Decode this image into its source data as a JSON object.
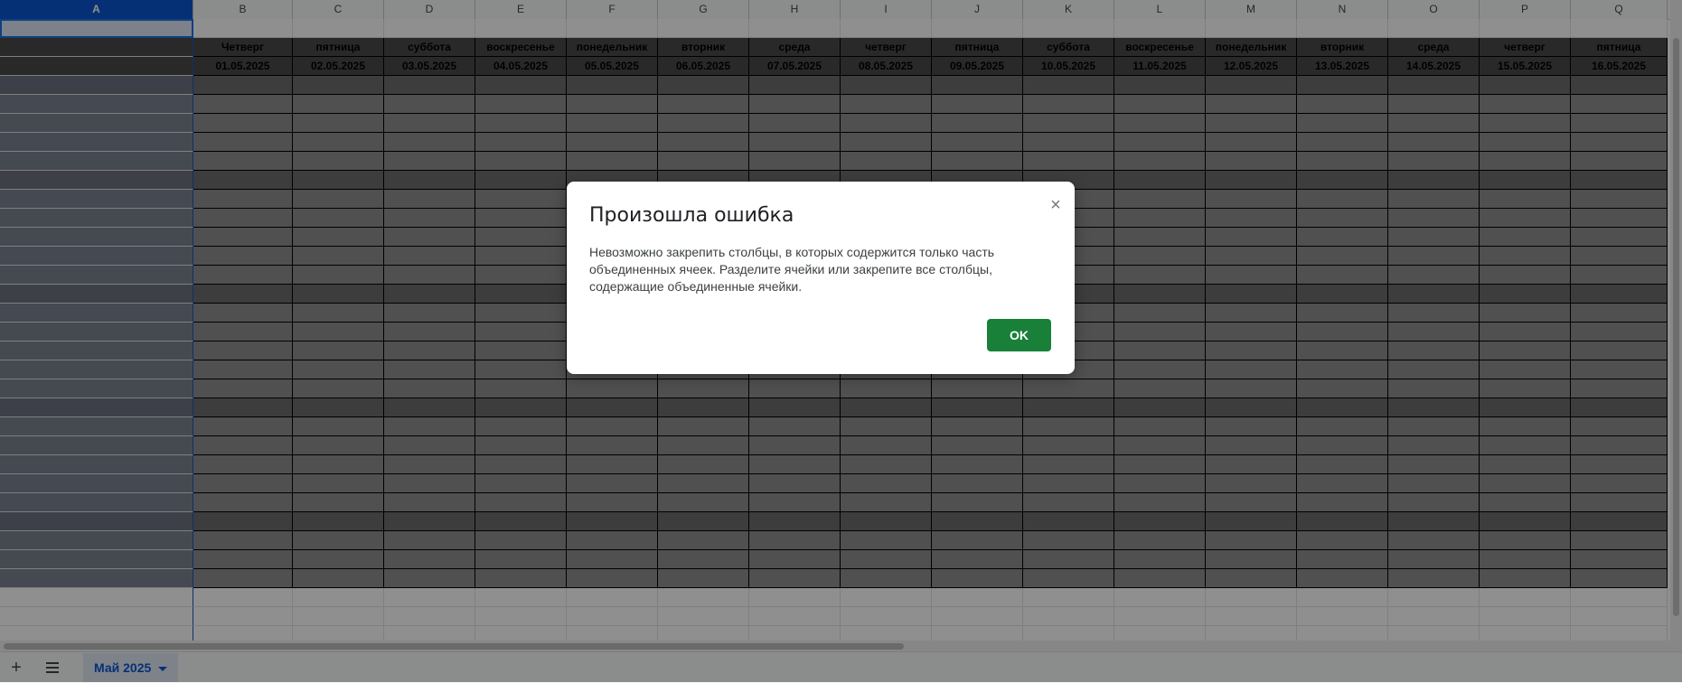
{
  "columns": [
    "A",
    "B",
    "C",
    "D",
    "E",
    "F",
    "G",
    "H",
    "I",
    "J",
    "K",
    "L",
    "M",
    "N",
    "O",
    "P",
    "Q"
  ],
  "active_column": "A",
  "weekdays": [
    "Четверг",
    "пятница",
    "суббота",
    "воскресенье",
    "понедельник",
    "вторник",
    "среда",
    "четверг",
    "пятница",
    "суббота",
    "воскресенье",
    "понедельник",
    "вторник",
    "среда",
    "четверг",
    "пятница"
  ],
  "dates": [
    "01.05.2025",
    "02.05.2025",
    "03.05.2025",
    "04.05.2025",
    "05.05.2025",
    "06.05.2025",
    "07.05.2025",
    "08.05.2025",
    "09.05.2025",
    "10.05.2025",
    "11.05.2025",
    "12.05.2025",
    "13.05.2025",
    "14.05.2025",
    "15.05.2025",
    "16.05.2025"
  ],
  "sheet": {
    "add_icon": "plus-icon",
    "list_icon": "menu-icon",
    "tab_label": "Май 2025"
  },
  "dialog": {
    "title": "Произошла ошибка",
    "close_symbol": "×",
    "message": "Невозможно закрепить столбцы, в которых содержится только часть объединенных ячеек. Разделите ячейки или закрепите все столбцы, содержащие объединенные ячейки.",
    "ok_label": "OK"
  },
  "colors": {
    "ok_button": "#188038",
    "selected_header": "#0b57d0",
    "sheet_tab_text": "#0b57d0"
  }
}
